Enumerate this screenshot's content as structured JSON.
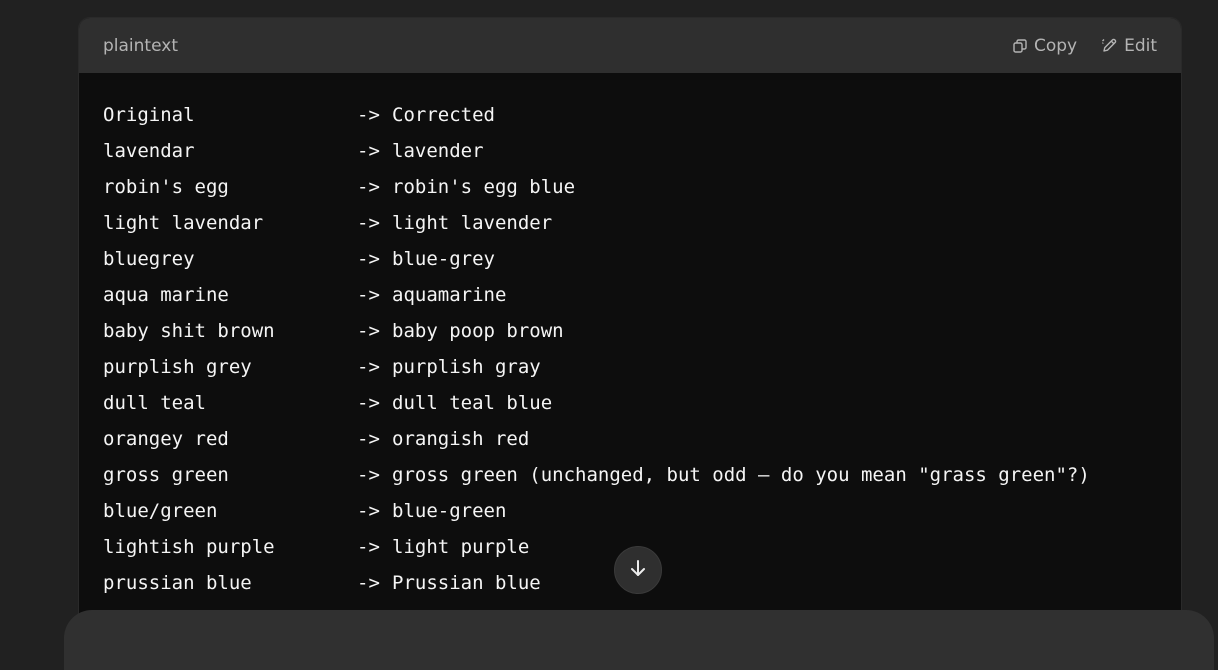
{
  "code_block": {
    "language": "plaintext",
    "copy_label": "Copy",
    "edit_label": "Edit",
    "arrow": "->",
    "rows": [
      {
        "original": "Original",
        "corrected": "Corrected"
      },
      {
        "original": "lavendar",
        "corrected": "lavender"
      },
      {
        "original": "robin's egg",
        "corrected": "robin's egg blue"
      },
      {
        "original": "light lavendar",
        "corrected": "light lavender"
      },
      {
        "original": "bluegrey",
        "corrected": "blue-grey"
      },
      {
        "original": "aqua marine",
        "corrected": "aquamarine"
      },
      {
        "original": "baby shit brown",
        "corrected": "baby poop brown"
      },
      {
        "original": "purplish grey",
        "corrected": "purplish gray"
      },
      {
        "original": "dull teal",
        "corrected": "dull teal blue"
      },
      {
        "original": "orangey red",
        "corrected": "orangish red"
      },
      {
        "original": "gross green",
        "corrected": "gross green (unchanged, but odd — do you mean \"grass green\"?)"
      },
      {
        "original": "blue/green",
        "corrected": "blue-green"
      },
      {
        "original": "lightish purple",
        "corrected": "light purple"
      },
      {
        "original": "prussian blue",
        "corrected": "Prussian blue"
      }
    ]
  },
  "icons": {
    "copy": "copy-icon",
    "edit": "pencil-icon",
    "scroll_down": "arrow-down-icon"
  },
  "colors": {
    "page_background": "#212121",
    "code_background": "#0d0d0d",
    "header_background": "#2f2f2f",
    "code_text": "#f5f5f5",
    "muted_text": "#b4b4b4"
  }
}
